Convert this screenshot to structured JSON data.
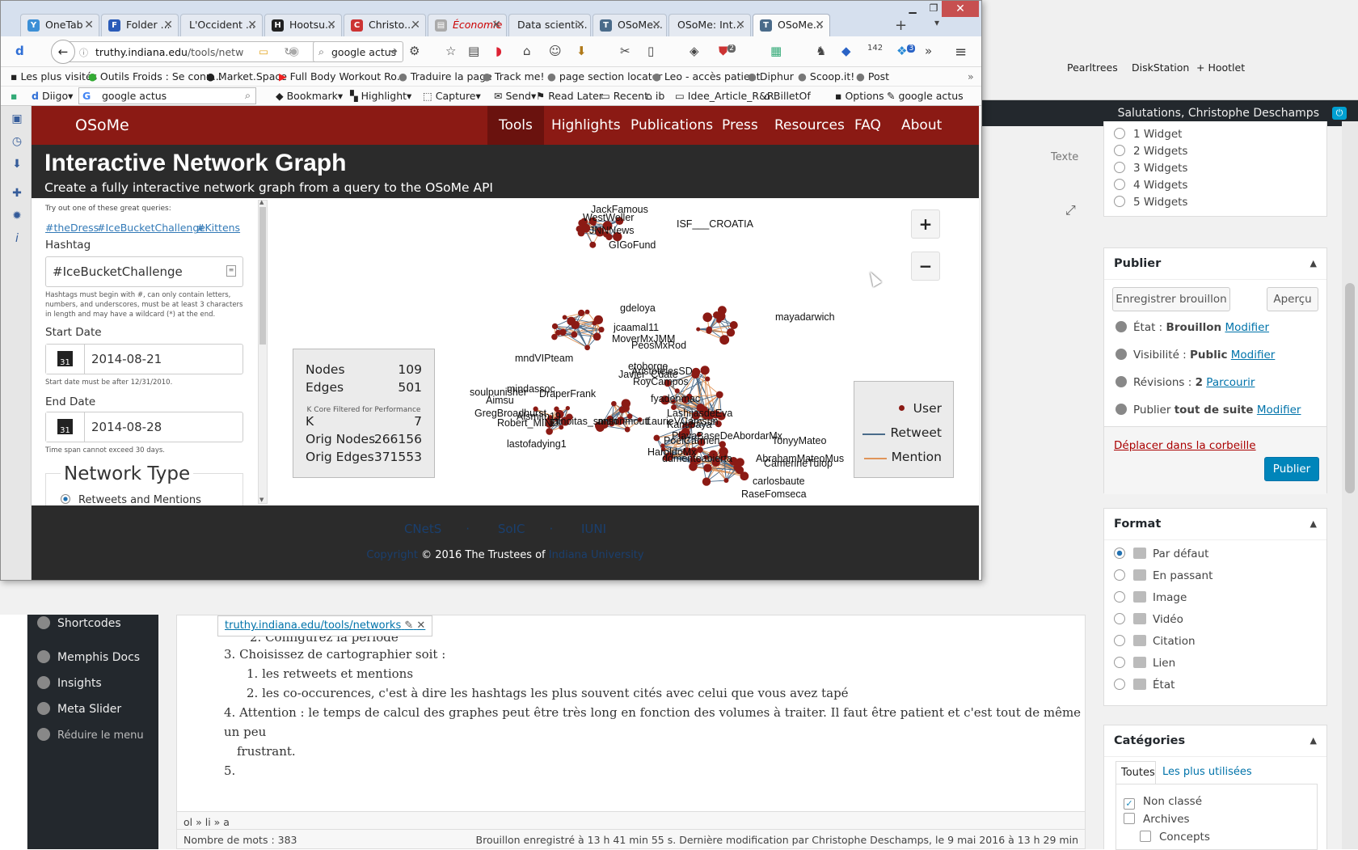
{
  "browser": {
    "tabs": [
      {
        "label": "OneTab",
        "icon": "onetab-icon"
      },
      {
        "label": "Folder ...",
        "icon": "folder-icon"
      },
      {
        "label": "L'Occident ...",
        "icon": "page-icon"
      },
      {
        "label": "Hootsu...",
        "icon": "hootsuite-icon"
      },
      {
        "label": "Christo...",
        "icon": "page-icon"
      },
      {
        "label": "Économie",
        "icon": "page-icon"
      },
      {
        "label": "Data scienti...",
        "icon": "page-icon"
      },
      {
        "label": "OSoMe...",
        "icon": "osome-icon"
      },
      {
        "label": "OSoMe: Int...",
        "icon": "osome-icon"
      },
      {
        "label": "OSoMe...",
        "icon": "osome-icon"
      }
    ],
    "url_host": "truthy.indiana.edu",
    "url_path": "/tools/netw",
    "search_value": "google actus",
    "bookmarks": [
      "Les plus visités",
      "Outils Froids : Se conn...",
      "Market.Space",
      "Full Body Workout Ro...",
      "Traduire la page",
      "Track me!",
      "page section locator",
      "Leo - accès patient",
      "Diphur",
      "Scoop.it!",
      "Post"
    ],
    "toolbar2": {
      "diigo": "Diigo",
      "search_value": "google actus",
      "items": [
        "Bookmark",
        "Highlight",
        "Capture",
        "Send",
        "Read Later",
        "Recent",
        "ib",
        "Idee_Article_R&R",
        "BilletOf",
        "Options",
        "google  actus"
      ]
    },
    "badges": {
      "ext1": "2",
      "ext2": "142",
      "ext3": "3"
    }
  },
  "osome": {
    "brand": "OSoMe",
    "nav": [
      "Tools",
      "Highlights",
      "Publications",
      "Press",
      "Resources",
      "FAQ",
      "About"
    ],
    "active_nav": "Tools",
    "title": "Interactive Network Graph",
    "subtitle": "Create a fully interactive network graph from a query to the OSoMe API",
    "form": {
      "try_text": "Try out one of these great queries:",
      "queries": [
        "#theDress",
        "#IceBucketChallenge",
        "#Kittens"
      ],
      "hashtag_label": "Hashtag",
      "hashtag_value": "#IceBucketChallenge",
      "hashtag_help": "Hashtags must begin with #, can only contain letters, numbers, and underscores, must be at least 3 characters in length and may have a wildcard (*) at the end.",
      "start_label": "Start Date",
      "start_value": "2014-08-21",
      "start_help": "Start date must be after 12/31/2010.",
      "end_label": "End Date",
      "end_value": "2014-08-28",
      "end_help": "Time span cannot exceed 30 days.",
      "calendar_icon_text": "31",
      "network_type_label": "Network Type",
      "network_type_option": "Retweets and Mentions"
    },
    "stats": {
      "nodes_label": "Nodes",
      "nodes": "109",
      "edges_label": "Edges",
      "edges": "501",
      "note": "K Core Filtered for Performance",
      "k_label": "K",
      "k": "7",
      "orig_nodes_label": "Orig Nodes",
      "orig_nodes": "266156",
      "orig_edges_label": "Orig Edges",
      "orig_edges": "371553"
    },
    "legend": {
      "user": "User",
      "retweet": "Retweet",
      "mention": "Mention"
    },
    "colors": {
      "user": "#8b1a14",
      "retweet": "#4a6b8a",
      "mention": "#e0955a",
      "nav": "#8b1a14"
    },
    "graph_labels": [
      "JackFamous",
      "WestWeller",
      "ISF___CROATIA",
      "JNNNews",
      "GIGoFund",
      "gdeloya",
      "jcaamal11",
      "MoverMxJMM",
      "PeosMxRod",
      "etoborge",
      "AristotelesSD",
      "Javier_Cdate",
      "RoyCampos",
      "mayadarwich",
      "mndVIPteam",
      "mindassoc",
      "soulpunisher",
      "DraperFrank",
      "Aimsu",
      "GregBroadhurst",
      "Robert_MIND",
      "Alsmith19",
      "jainoitas_smith",
      "ansonmoutf",
      "lastofadying1",
      "fyadenmac",
      "LashijasdeEva",
      "LaurieVCamsun",
      "Kantibaya",
      "PlayaBaseDeAbordarMx",
      "PoelCarmen",
      "TonyyMateo",
      "AbrahamMateoMus",
      "ddmenteabierta",
      "HaroldoMx",
      "CamerineTulop",
      "carlosbaute",
      "RaseFomseca"
    ],
    "footer": {
      "links": [
        "CNetS",
        "SoIC",
        "IUNI"
      ],
      "copyright_link": "Copyright",
      "copyright_text": "© 2016 The Trustees of",
      "university": "Indiana University"
    }
  },
  "wordpress": {
    "greeting": "Salutations, Christophe Deschamps",
    "texte_tab": "Texte",
    "widgets": [
      "1 Widget",
      "2 Widgets",
      "3 Widgets",
      "4 Widgets",
      "5 Widgets"
    ],
    "publish": {
      "title": "Publier",
      "save_draft": "Enregistrer brouillon",
      "preview": "Aperçu",
      "status_label": "État :",
      "status_value": "Brouillon",
      "status_link": "Modifier",
      "visibility_label": "Visibilité :",
      "visibility_value": "Public",
      "visibility_link": "Modifier",
      "revisions_label": "Révisions :",
      "revisions_value": "2",
      "revisions_link": "Parcourir",
      "publish_label": "Publier",
      "publish_value": "tout de suite",
      "publish_link": "Modifier",
      "trash": "Déplacer dans la corbeille",
      "publish_button": "Publier"
    },
    "format": {
      "title": "Format",
      "options": [
        "Par défaut",
        "En passant",
        "Image",
        "Vidéo",
        "Citation",
        "Lien",
        "État"
      ]
    },
    "categories": {
      "title": "Catégories",
      "tab_all": "Toutes",
      "tab_used": "Les plus utilisées",
      "items": [
        "Non classé",
        "Archives",
        "Concepts"
      ]
    },
    "sidebar": [
      "Shortcodes",
      "Memphis Docs",
      "Insights",
      "Meta Slider",
      "Réduire le menu"
    ],
    "editor": {
      "link_chip": "truthy.indiana.edu/tools/networks",
      "partial_line": "2. Configurez la période",
      "item3": "3. Choisissez de cartographier soit :",
      "sub1": "1. les retweets et mentions",
      "sub2": "2. les co-occurences, c'est à dire les hashtags les plus souvent cités avec celui que vous avez tapé",
      "item4": "4. Attention : le temps de calcul des graphes peut être très long en fonction des volumes à traiter. Il faut être patient et c'est tout de même un peu",
      "item4b": "frustrant.",
      "item5": "5.",
      "breadcrumb": "ol » li » a",
      "word_count": "Nombre de mots : 383",
      "saved": "Brouillon enregistré à 13 h 41 min 55 s. Dernière modification par Christophe Deschamps, le 9 mai 2016 à 13 h 29 min"
    },
    "right_bookmarks": [
      "Pearltrees",
      "DiskStation",
      "+ Hootlet"
    ]
  }
}
